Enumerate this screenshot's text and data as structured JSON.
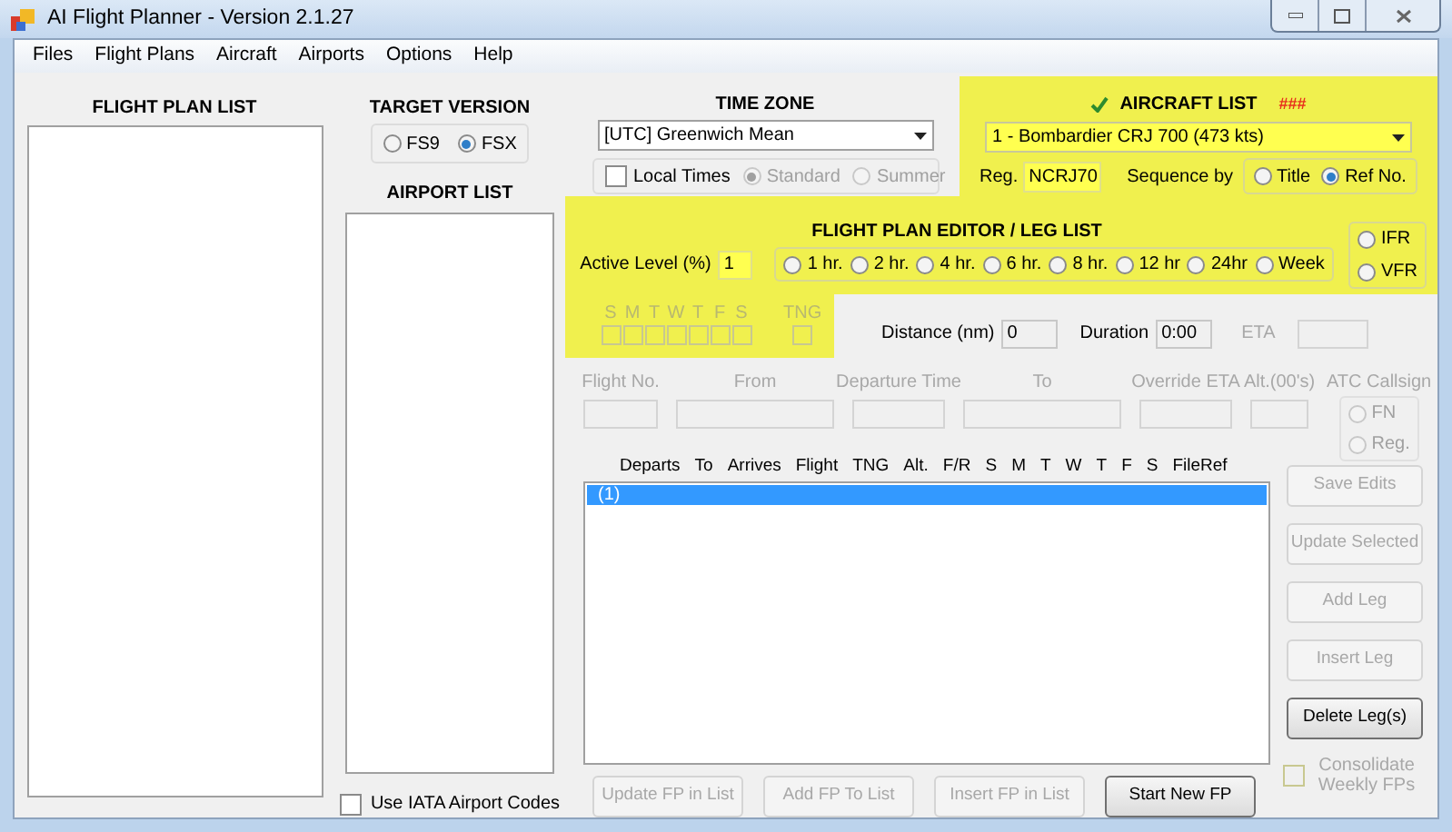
{
  "window": {
    "title": "AI Flight Planner - Version 2.1.27"
  },
  "menu": [
    "Files",
    "Flight Plans",
    "Aircraft",
    "Airports",
    "Options",
    "Help"
  ],
  "flight_plan_list": {
    "title": "FLIGHT PLAN LIST"
  },
  "target_version": {
    "title": "TARGET VERSION",
    "options": [
      {
        "label": "FS9",
        "selected": false
      },
      {
        "label": "FSX",
        "selected": true
      }
    ]
  },
  "airport_list": {
    "title": "AIRPORT LIST",
    "iata": {
      "label": "Use IATA Airport Codes",
      "checked": false
    }
  },
  "time_zone": {
    "title": "TIME ZONE",
    "value": "[UTC] Greenwich Mean",
    "local_times": {
      "label": "Local Times",
      "checked": false
    },
    "season": [
      {
        "label": "Standard",
        "selected": true,
        "disabled": true
      },
      {
        "label": "Summer",
        "selected": false,
        "disabled": true
      }
    ]
  },
  "aircraft_list": {
    "title": "AIRCRAFT LIST",
    "status": "###",
    "value": "1 - Bombardier CRJ 700 (473 kts)",
    "reg_label": "Reg.",
    "reg_value": "NCRJ70",
    "sequence_label": "Sequence by",
    "sequence": [
      {
        "label": "Title",
        "selected": false
      },
      {
        "label": "Ref No.",
        "selected": true
      }
    ]
  },
  "editor": {
    "title": "FLIGHT PLAN EDITOR / LEG LIST",
    "active_level_label": "Active Level (%)",
    "active_level_value": "1",
    "periods": [
      {
        "label": "1 hr.",
        "selected": false
      },
      {
        "label": "2 hr.",
        "selected": false
      },
      {
        "label": "4 hr.",
        "selected": false
      },
      {
        "label": "6 hr.",
        "selected": false
      },
      {
        "label": "8 hr.",
        "selected": false
      },
      {
        "label": "12 hr",
        "selected": false
      },
      {
        "label": "24hr",
        "selected": false
      },
      {
        "label": "Week",
        "selected": false
      }
    ],
    "rules": [
      {
        "label": "IFR",
        "selected": false
      },
      {
        "label": "VFR",
        "selected": false
      }
    ],
    "days": [
      {
        "label": "S",
        "checked": false
      },
      {
        "label": "M",
        "checked": false
      },
      {
        "label": "T",
        "checked": false
      },
      {
        "label": "W",
        "checked": false
      },
      {
        "label": "T",
        "checked": false
      },
      {
        "label": "F",
        "checked": false
      },
      {
        "label": "S",
        "checked": false
      }
    ],
    "tng": {
      "label": "TNG",
      "checked": false
    },
    "distance": {
      "label": "Distance (nm)",
      "value": "0"
    },
    "duration": {
      "label": "Duration",
      "value": "0:00"
    },
    "eta": {
      "label": "ETA"
    },
    "fields": [
      {
        "label": "Flight No.",
        "kind": "flight"
      },
      {
        "label": "From",
        "kind": "wide"
      },
      {
        "label": "Departure Time",
        "kind": "time"
      },
      {
        "label": "To",
        "kind": "wide"
      },
      {
        "label": "Override ETA",
        "kind": "time"
      },
      {
        "label": "Alt.(00's)",
        "kind": "alt"
      }
    ],
    "atc_callsign": {
      "label": "ATC Callsign",
      "options": [
        {
          "label": "FN",
          "selected": false
        },
        {
          "label": "Reg.",
          "selected": false
        }
      ]
    },
    "columns": [
      "Departs",
      "To",
      "Arrives",
      "Flight",
      "TNG",
      "Alt.",
      "F/R",
      "S",
      "M",
      "T",
      "W",
      "T",
      "F",
      "S",
      "FileRef"
    ],
    "rows": [
      {
        "text": "(1)",
        "selected": true
      }
    ],
    "side_buttons": [
      {
        "label": "Save Edits",
        "disabled": true
      },
      {
        "label": "Update Selected",
        "disabled": true
      },
      {
        "label": "Add Leg",
        "disabled": true
      },
      {
        "label": "Insert Leg",
        "disabled": true
      },
      {
        "label": "Delete Leg(s)",
        "disabled": false
      }
    ],
    "bottom_buttons": [
      {
        "label": "Update FP in List",
        "disabled": true
      },
      {
        "label": "Add FP To List",
        "disabled": true
      },
      {
        "label": "Insert FP in List",
        "disabled": true
      },
      {
        "label": "Start New FP",
        "disabled": false
      }
    ],
    "consolidate": {
      "label": "Consolidate Weekly FPs",
      "checked": false,
      "disabled": true
    }
  }
}
